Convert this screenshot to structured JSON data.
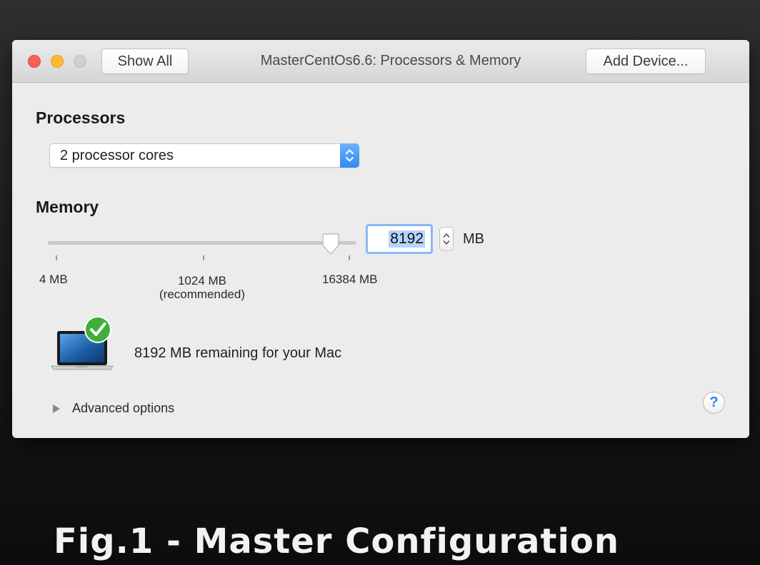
{
  "window": {
    "title": "MasterCentOs6.6: Processors & Memory",
    "toolbar": {
      "show_all_label": "Show All",
      "add_device_label": "Add Device..."
    }
  },
  "processors": {
    "heading": "Processors",
    "selected_option": "2 processor cores"
  },
  "memory": {
    "heading": "Memory",
    "value": "8192",
    "unit": "MB",
    "slider": {
      "min_label": "4 MB",
      "recommended_label": "1024 MB",
      "recommended_note": "(recommended)",
      "max_label": "16384 MB",
      "current_value_mb": 8192
    },
    "remaining_text": "8192 MB remaining for your Mac"
  },
  "advanced": {
    "label": "Advanced options"
  },
  "help": {
    "label": "?"
  },
  "caption": "Fig.1 - Master Configuration",
  "icons": {
    "close": "close-icon",
    "minimize": "minimize-icon",
    "zoom": "zoom-icon",
    "popup_arrows": "chevron-up-down-icon",
    "stepper": "stepper-icon",
    "laptop": "laptop-icon",
    "check": "checkmark-icon",
    "disclosure": "disclosure-triangle-icon"
  },
  "colors": {
    "close": "#fc5f57",
    "minimize": "#fdbb2e",
    "zoom": "#cfcfcf",
    "accent": "#2e8af5",
    "check_badge": "#3fae3a",
    "selection": "#b4d4fd",
    "focus_ring": "#8ab9f3"
  }
}
